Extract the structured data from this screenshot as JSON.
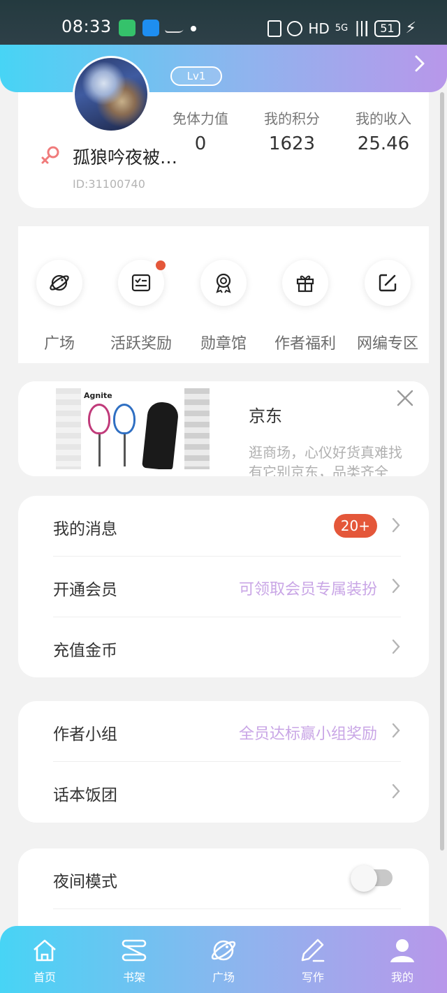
{
  "status_bar": {
    "time": "08:33",
    "network": "HD",
    "signal": "5G",
    "battery": "51"
  },
  "profile": {
    "level": "Lv1",
    "username": "孤狼吟夜被…",
    "user_id": "ID:31100740",
    "stats": [
      {
        "label": "免体力值",
        "value": "0"
      },
      {
        "label": "我的积分",
        "value": "1623"
      },
      {
        "label": "我的收入",
        "value": "25.46"
      }
    ]
  },
  "features": [
    {
      "label": "广场",
      "icon": "planet-icon"
    },
    {
      "label": "活跃奖励",
      "icon": "checklist-icon",
      "has_dot": true
    },
    {
      "label": "勋章馆",
      "icon": "medal-icon"
    },
    {
      "label": "作者福利",
      "icon": "gift-icon"
    },
    {
      "label": "网编专区",
      "icon": "edit-icon"
    }
  ],
  "ad": {
    "brand": "Agnite",
    "title": "京东",
    "desc_line1": "逛商场，心仪好货真难找",
    "desc_line2": "有它别京东，品类齐全"
  },
  "menu_group_1": [
    {
      "label": "我的消息",
      "badge": "20+"
    },
    {
      "label": "开通会员",
      "hint": "可领取会员专属装扮"
    },
    {
      "label": "充值金币"
    }
  ],
  "menu_group_2": [
    {
      "label": "作者小组",
      "hint": "全员达标赢小组奖励"
    },
    {
      "label": "话本饭团"
    }
  ],
  "menu_group_3": [
    {
      "label": "夜间模式",
      "toggle": "off"
    }
  ],
  "tabbar": [
    {
      "label": "首页",
      "icon": "home-icon"
    },
    {
      "label": "书架",
      "icon": "bookshelf-icon"
    },
    {
      "label": "广场",
      "icon": "planet-icon"
    },
    {
      "label": "写作",
      "icon": "pen-icon"
    },
    {
      "label": "我的",
      "icon": "user-icon",
      "active": true
    }
  ],
  "colors": {
    "gradient_start": "#47d4f5",
    "gradient_end": "#b897ea",
    "badge_red": "#e4573a",
    "hint_purple": "#c9a6e6"
  }
}
